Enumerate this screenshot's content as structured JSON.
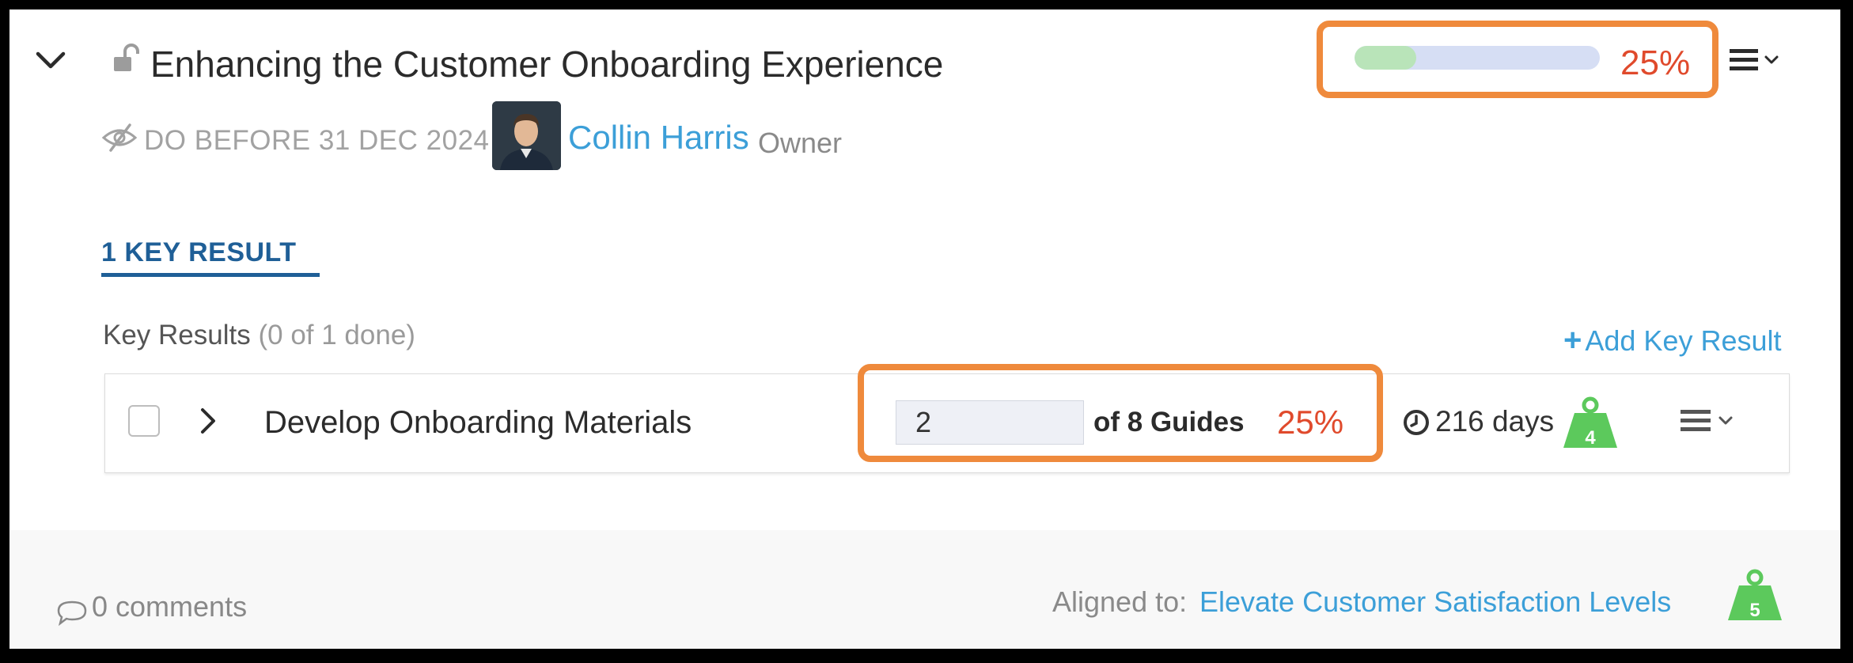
{
  "objective": {
    "title": "Enhancing the Customer Onboarding Experience",
    "progress_fraction": 0.25,
    "progress_label": "25%",
    "due": "DO BEFORE 31 DEC 2024",
    "owner_name": "Collin Harris",
    "owner_role": "Owner"
  },
  "tabs": [
    {
      "label": "1 KEY RESULT",
      "active": true
    }
  ],
  "key_results_section": {
    "heading": "Key Results",
    "status": "(0 of 1 done)",
    "add_label": "Add Key Result",
    "add_symbol": "+"
  },
  "key_results": [
    {
      "title": "Develop Onboarding Materials",
      "current_value": "2",
      "target_label": "of 8 Guides",
      "percent_label": "25%",
      "due_in": "216 days",
      "weight": "4"
    }
  ],
  "footer": {
    "comments": "0 comments",
    "aligned_label": "Aligned to:",
    "aligned_objective": "Elevate Customer Satisfaction Levels",
    "weight": "5"
  },
  "colors": {
    "accent_blue": "#3c9fd8",
    "tab_blue": "#1f5f97",
    "progress_track": "#d6def4",
    "progress_fill": "#b9e4b9",
    "percent_red": "#e04a2c",
    "highlight_orange": "#ef8a3c",
    "weight_green": "#5cc95c"
  },
  "icons": {
    "collapse": "chevron-down-icon",
    "lock": "unlocked-padlock-icon",
    "visibility": "eye-slash-icon",
    "menu": "hamburger-menu-icon",
    "expand": "chevron-right-icon",
    "clock": "clock-icon",
    "weight": "kettlebell-weight-icon",
    "comment": "speech-bubble-icon"
  }
}
